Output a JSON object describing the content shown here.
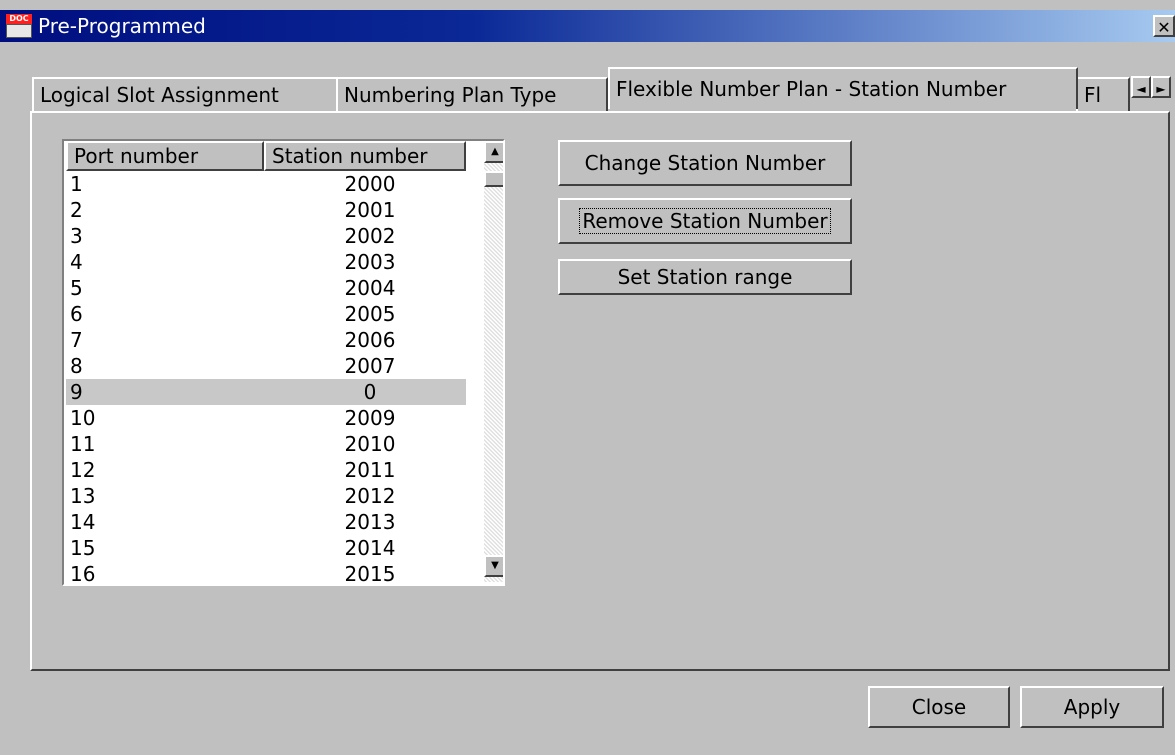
{
  "window": {
    "title": "Pre-Programmed",
    "close_glyph": "✕",
    "icon_text": "DOC"
  },
  "tabs": [
    {
      "label": "Logical Slot Assignment"
    },
    {
      "label": "Numbering Plan Type"
    },
    {
      "label": "Flexible Number Plan - Station Number"
    },
    {
      "label": "Fl"
    }
  ],
  "tab_scroll": {
    "left": "◄",
    "right": "►"
  },
  "list": {
    "columns": [
      "Port number",
      "Station number"
    ],
    "rows": [
      {
        "port": "1",
        "station": "2000"
      },
      {
        "port": "2",
        "station": "2001"
      },
      {
        "port": "3",
        "station": "2002"
      },
      {
        "port": "4",
        "station": "2003"
      },
      {
        "port": "5",
        "station": "2004"
      },
      {
        "port": "6",
        "station": "2005"
      },
      {
        "port": "7",
        "station": "2006"
      },
      {
        "port": "8",
        "station": "2007"
      },
      {
        "port": "9",
        "station": "0"
      },
      {
        "port": "10",
        "station": "2009"
      },
      {
        "port": "11",
        "station": "2010"
      },
      {
        "port": "12",
        "station": "2011"
      },
      {
        "port": "13",
        "station": "2012"
      },
      {
        "port": "14",
        "station": "2013"
      },
      {
        "port": "15",
        "station": "2014"
      },
      {
        "port": "16",
        "station": "2015"
      }
    ],
    "selected_port": "9",
    "scroll_up": "▲",
    "scroll_down": "▼"
  },
  "actions": {
    "change_label": "Change Station Number",
    "remove_label": "Remove Station Number",
    "range_label": "Set Station range"
  },
  "footer": {
    "close_label": "Close",
    "apply_label": "Apply"
  }
}
